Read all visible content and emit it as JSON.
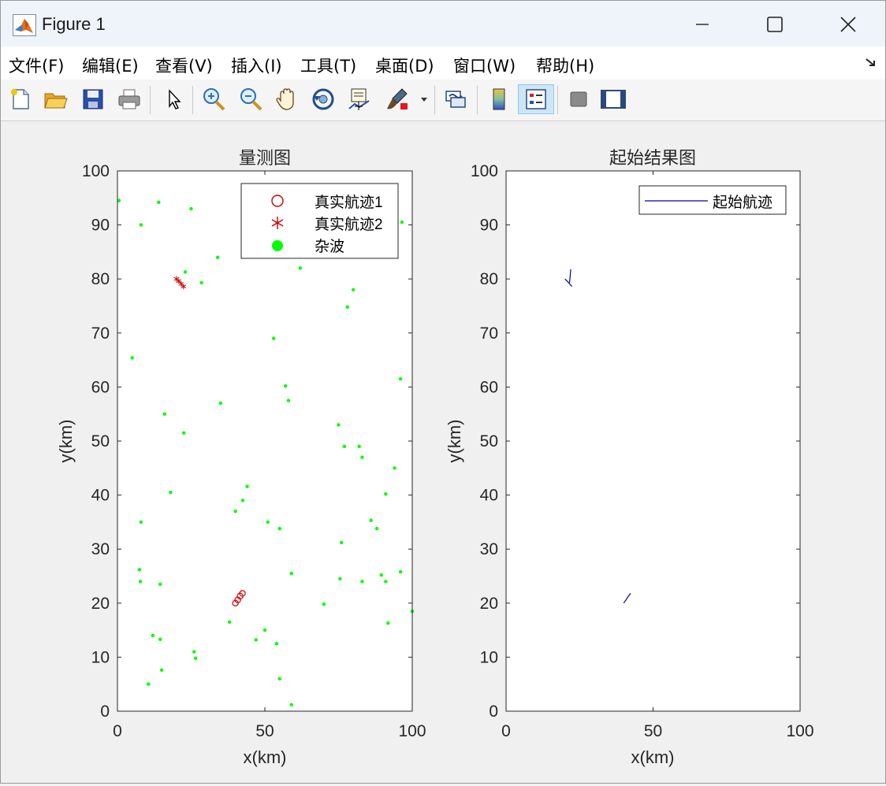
{
  "window": {
    "title": "Figure 1"
  },
  "menu": [
    "文件(F)",
    "编辑(E)",
    "查看(V)",
    "插入(I)",
    "工具(T)",
    "桌面(D)",
    "窗口(W)",
    "帮助(H)"
  ],
  "toolbar": [
    "new-figure-icon",
    "open-file-icon",
    "save-icon",
    "print-icon",
    "pointer-icon",
    "zoom-in-icon",
    "zoom-out-icon",
    "pan-icon",
    "rotate-3d-icon",
    "data-cursor-icon",
    "brush-icon",
    "link-plot-icon",
    "colorbar-icon",
    "legend-icon",
    "hide-plot-tools-icon",
    "show-plot-tools-icon"
  ],
  "colors": {
    "clutter": "#00ff00",
    "truth": "#cc0000",
    "track": "#0000aa",
    "plot_bg": "#ffffff",
    "fig_bg": "#f0f0f0"
  },
  "chart_data": [
    {
      "type": "scatter",
      "title": "量测图",
      "xlabel": "x(km)",
      "ylabel": "y(km)",
      "xlim": [
        0,
        100
      ],
      "ylim": [
        0,
        100
      ],
      "xticks": [
        "0",
        "50",
        "100"
      ],
      "yticks": [
        "0",
        "10",
        "20",
        "30",
        "40",
        "50",
        "60",
        "70",
        "80",
        "90",
        "100"
      ],
      "legend_position": "top-right",
      "series": [
        {
          "name": "真实航迹1",
          "marker": "circle-open",
          "color": "#cc0000",
          "points": [
            [
              40,
              20
            ],
            [
              40.8,
              20.6
            ],
            [
              41.6,
              21.3
            ],
            [
              42.4,
              21.8
            ]
          ]
        },
        {
          "name": "真实航迹2",
          "marker": "asterisk",
          "color": "#cc0000",
          "points": [
            [
              20,
              80
            ],
            [
              20.8,
              79.6
            ],
            [
              21.6,
              79.1
            ],
            [
              22.4,
              78.6
            ]
          ]
        },
        {
          "name": "杂波",
          "marker": "dot",
          "color": "#00ff00",
          "points": [
            [
              0.5,
              94.5
            ],
            [
              14,
              94.2
            ],
            [
              25,
              93
            ],
            [
              8,
              90
            ],
            [
              96.5,
              90.5
            ],
            [
              34,
              84
            ],
            [
              62,
              82
            ],
            [
              23,
              81.3
            ],
            [
              28.5,
              79.3
            ],
            [
              80,
              78
            ],
            [
              78,
              74.8
            ],
            [
              53,
              69
            ],
            [
              5,
              65.4
            ],
            [
              96,
              61.5
            ],
            [
              57,
              60.2
            ],
            [
              58,
              57.5
            ],
            [
              35,
              57
            ],
            [
              16,
              55
            ],
            [
              75,
              53
            ],
            [
              22.5,
              51.5
            ],
            [
              77,
              49
            ],
            [
              82,
              49
            ],
            [
              83,
              47
            ],
            [
              94,
              45
            ],
            [
              44,
              41.6
            ],
            [
              18,
              40.5
            ],
            [
              91,
              40.2
            ],
            [
              42.5,
              39
            ],
            [
              40,
              37
            ],
            [
              8,
              35
            ],
            [
              51,
              35
            ],
            [
              86,
              35.3
            ],
            [
              55,
              33.8
            ],
            [
              88,
              33.8
            ],
            [
              76,
              31.2
            ],
            [
              7.5,
              26.2
            ],
            [
              59,
              25.5
            ],
            [
              89.5,
              25.2
            ],
            [
              96,
              25.8
            ],
            [
              7.8,
              24
            ],
            [
              75.5,
              24.5
            ],
            [
              83,
              24
            ],
            [
              91,
              24
            ],
            [
              14.5,
              23.5
            ],
            [
              70,
              19.8
            ],
            [
              100,
              18.5
            ],
            [
              38,
              16.5
            ],
            [
              91.8,
              16.3
            ],
            [
              50,
              15
            ],
            [
              12,
              14
            ],
            [
              14.5,
              13.3
            ],
            [
              47,
              13.2
            ],
            [
              54,
              12.5
            ],
            [
              26,
              11
            ],
            [
              26.5,
              9.8
            ],
            [
              15,
              7.6
            ],
            [
              55,
              6
            ],
            [
              10.5,
              5
            ],
            [
              59,
              1.2
            ]
          ]
        }
      ]
    },
    {
      "type": "line",
      "title": "起始结果图",
      "xlabel": "x(km)",
      "ylabel": "y(km)",
      "xlim": [
        0,
        100
      ],
      "ylim": [
        0,
        100
      ],
      "xticks": [
        "0",
        "50",
        "100"
      ],
      "yticks": [
        "0",
        "10",
        "20",
        "30",
        "40",
        "50",
        "60",
        "70",
        "80",
        "90",
        "100"
      ],
      "legend_position": "top-right",
      "series": [
        {
          "name": "起始航迹",
          "color": "#0000aa",
          "lines": [
            [
              [
                40,
                20
              ],
              [
                40.8,
                20.6
              ],
              [
                41.6,
                21.3
              ],
              [
                42.4,
                21.8
              ]
            ],
            [
              [
                20,
                80
              ],
              [
                20.8,
                79.6
              ],
              [
                21.6,
                79.1
              ],
              [
                22.4,
                78.6
              ]
            ],
            [
              [
                21.6,
                79.3
              ],
              [
                21.8,
                80.5
              ],
              [
                22,
                81.8
              ]
            ]
          ]
        }
      ]
    }
  ]
}
